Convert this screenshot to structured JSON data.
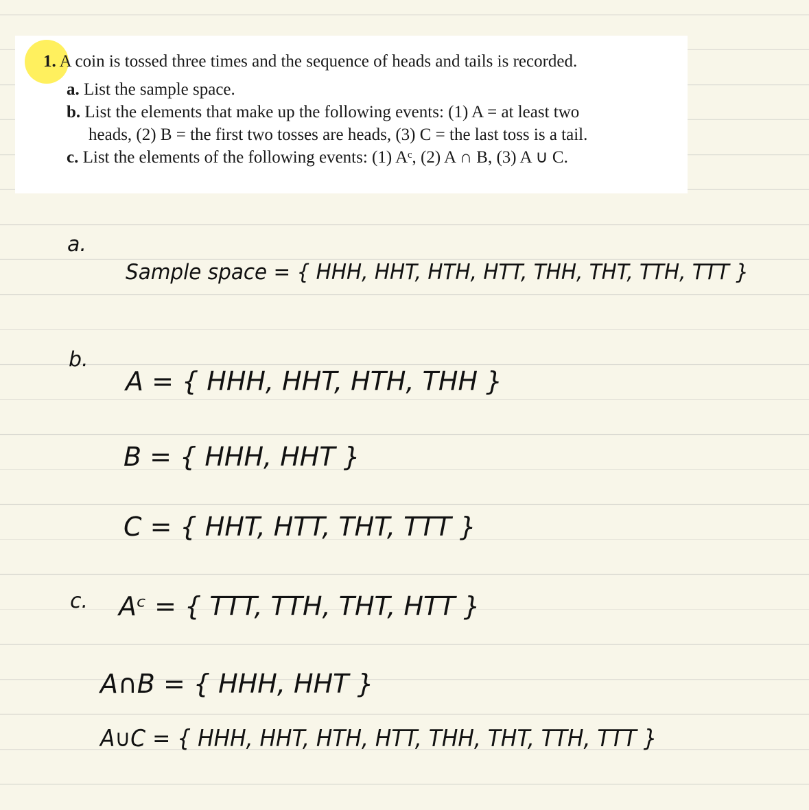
{
  "problem": {
    "number": "1.",
    "statement": "A coin is tossed three times and the sequence of heads and tails is recorded.",
    "part_a": {
      "label": "a.",
      "text": "List the sample space."
    },
    "part_b": {
      "label": "b.",
      "line1": "List the elements that make up the following events: (1) A = at least two",
      "line2": "heads, (2) B = the first two tosses are heads, (3) C = the last toss is a tail."
    },
    "part_c": {
      "label": "c.",
      "text": "List the elements of the following events: (1) Aᶜ, (2) A ∩ B, (3) A ∪ C."
    }
  },
  "answers": {
    "a_label": "a.",
    "sample_space": "Sample space = { HHH, HHT, HTH, HTT, THH, THT, TTH, TTT }",
    "b_label": "b.",
    "A": "A = { HHH, HHT, HTH, THH }",
    "B": "B = { HHH, HHT }",
    "C": "C = { HHT, HTT, THT, TTT }",
    "c_label": "c.",
    "A_complement": "Aᶜ = { TTT, TTH, THT, HTT }",
    "A_intersect_B": "A∩B = { HHH, HHT }",
    "A_union_C": "A∪C = { HHH, HHT, HTH, HTT, THH, THT, TTH, TTT }"
  }
}
